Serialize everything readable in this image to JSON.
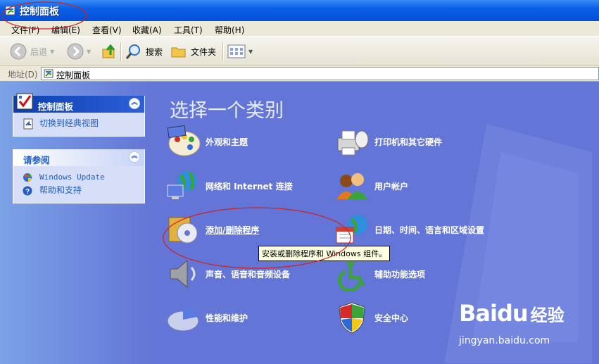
{
  "window": {
    "title": "控制面板"
  },
  "menu": [
    "文件(F)",
    "编辑(E)",
    "查看(V)",
    "收藏(A)",
    "工具(T)",
    "帮助(H)"
  ],
  "toolbar": {
    "back": "后退",
    "search": "搜索",
    "folders": "文件夹"
  },
  "address": {
    "label": "地址(D)",
    "value": "控制面板"
  },
  "sidebar": {
    "control_panel": {
      "title": "控制面板",
      "links": [
        "切换到经典视图"
      ]
    },
    "see_also": {
      "title": "请参阅",
      "links": [
        "Windows Update",
        "帮助和支持"
      ]
    }
  },
  "main": {
    "heading": "选择一个类别",
    "categories": [
      {
        "label": "外观和主题",
        "icon": "appearance-icon"
      },
      {
        "label": "打印机和其它硬件",
        "icon": "printer-icon"
      },
      {
        "label": "网络和 Internet 连接",
        "icon": "network-icon"
      },
      {
        "label": "用户帐户",
        "icon": "user-accounts-icon"
      },
      {
        "label": "添加/删除程序",
        "icon": "add-remove-programs-icon"
      },
      {
        "label": "日期、时间、语言和区域设置",
        "icon": "date-time-icon"
      },
      {
        "label": "声音、语音和音频设备",
        "icon": "sound-icon"
      },
      {
        "label": "辅助功能选项",
        "icon": "accessibility-icon"
      },
      {
        "label": "性能和维护",
        "icon": "performance-icon"
      },
      {
        "label": "安全中心",
        "icon": "security-center-icon"
      }
    ],
    "tooltip": "安装或删除程序和 Windows 组件。"
  },
  "watermark": {
    "brand": "Bai",
    "brand_paw": "du",
    "brand_cn": "经验",
    "url": "jingyan.baidu.com"
  },
  "colors": {
    "title_bar": "#0550d8",
    "content_bg": "#6375d6",
    "sidebar_link": "#215dc6",
    "annotation": "#d22020"
  }
}
